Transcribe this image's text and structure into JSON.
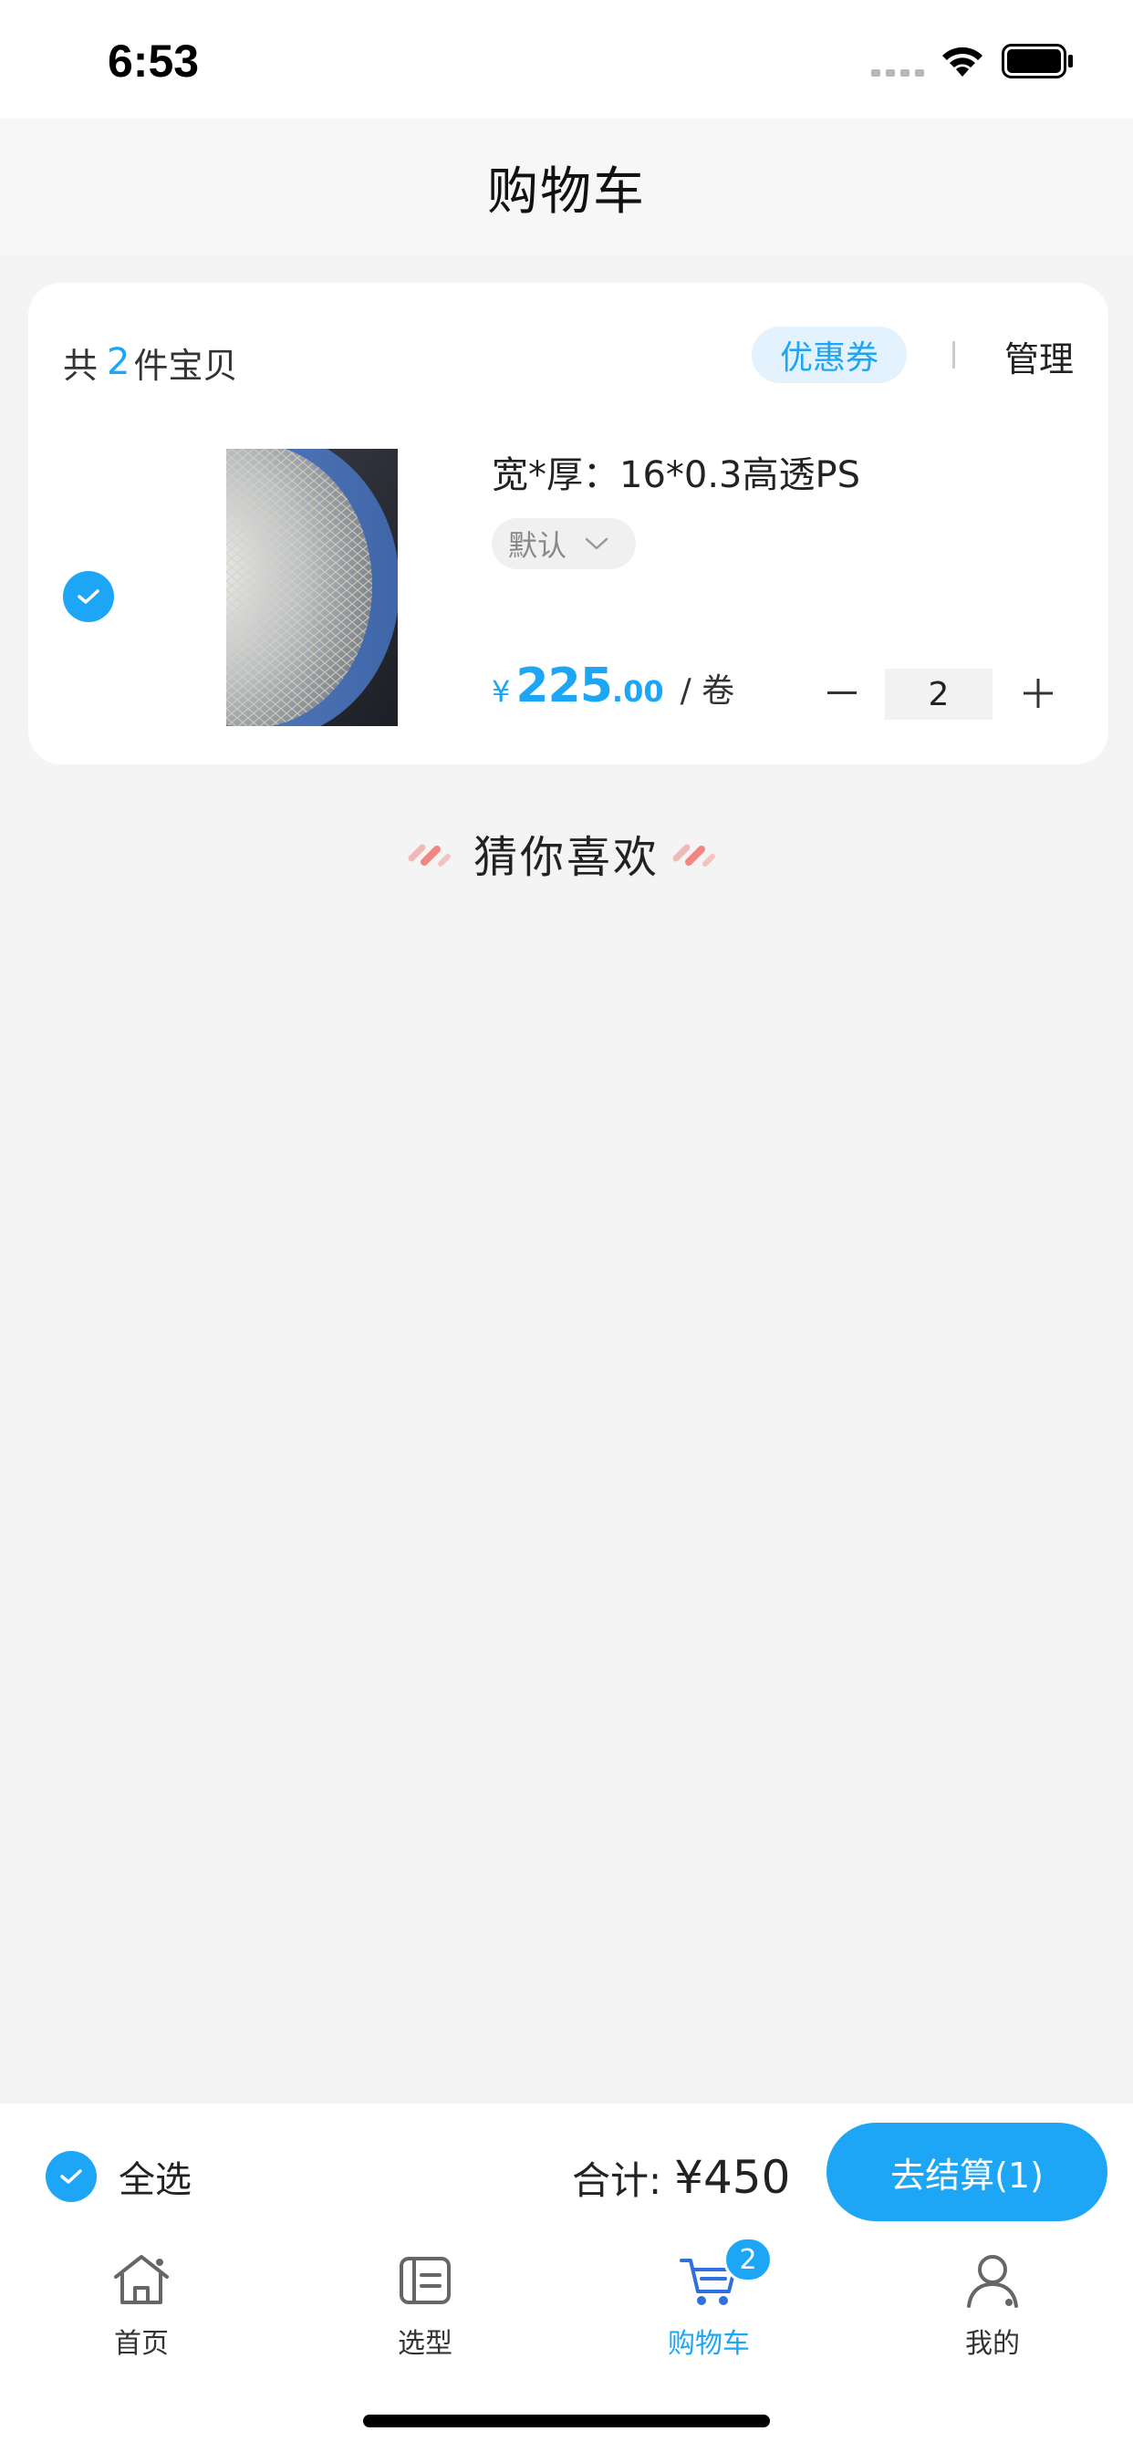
{
  "status_bar": {
    "time": "6:53"
  },
  "header": {
    "title": "购物车"
  },
  "cart": {
    "count_prefix": "共",
    "count": "2",
    "count_suffix": "件宝贝",
    "coupon_label": "优惠券",
    "manage_label": "管理",
    "items": [
      {
        "title": "宽*厚：16*0.3高透PS",
        "variant": "默认",
        "price_symbol": "¥",
        "price_integer": "225",
        "price_decimal": ".00",
        "unit": "/ 卷",
        "quantity": "2",
        "selected": true
      }
    ]
  },
  "guess": {
    "title": "猜你喜欢"
  },
  "checkout": {
    "select_all_label": "全选",
    "total_label": "合计:",
    "total_amount": "¥450",
    "checkout_label": "去结算(1)"
  },
  "tabs": [
    {
      "label": "首页",
      "icon": "home-icon",
      "active": false
    },
    {
      "label": "选型",
      "icon": "selection-icon",
      "active": false
    },
    {
      "label": "购物车",
      "icon": "cart-icon",
      "active": true,
      "badge": "2"
    },
    {
      "label": "我的",
      "icon": "profile-icon",
      "active": false
    }
  ],
  "colors": {
    "accent": "#1da6f5",
    "background": "#f4f4f4"
  }
}
